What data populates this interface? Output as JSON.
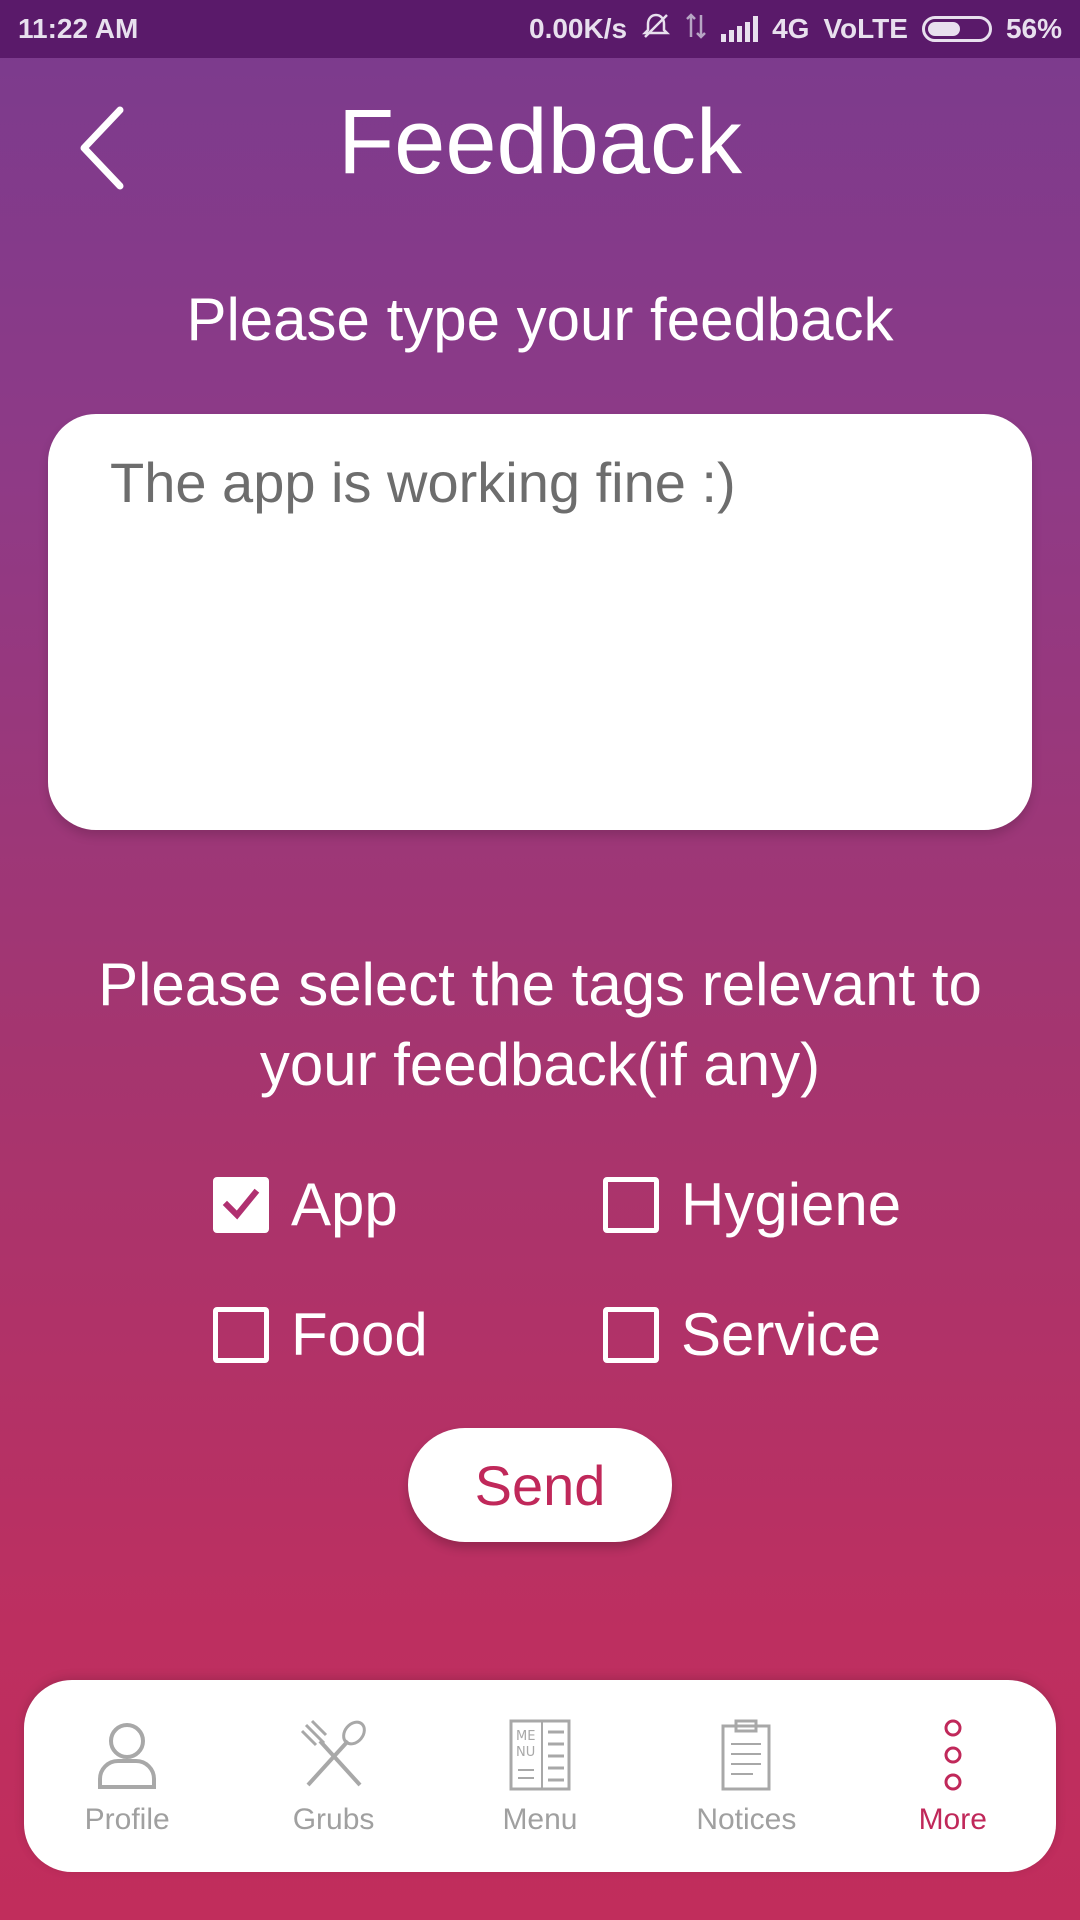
{
  "status_bar": {
    "time": "11:22 AM",
    "speed": "0.00K/s",
    "network": "4G",
    "volte": "VoLTE",
    "battery": "56%",
    "battery_level": 0.56
  },
  "header": {
    "title": "Feedback"
  },
  "feedback": {
    "prompt": "Please type your feedback",
    "value": "The app is working fine :)"
  },
  "tags": {
    "prompt": "Please select the tags relevant to your feedback(if any)",
    "items": [
      {
        "label": "App",
        "checked": true
      },
      {
        "label": "Hygiene",
        "checked": false
      },
      {
        "label": "Food",
        "checked": false
      },
      {
        "label": "Service",
        "checked": false
      }
    ]
  },
  "send_label": "Send",
  "bottom_nav": {
    "items": [
      {
        "label": "Profile",
        "icon": "person-icon"
      },
      {
        "label": "Grubs",
        "icon": "fork-spoon-icon"
      },
      {
        "label": "Menu",
        "icon": "menu-card-icon"
      },
      {
        "label": "Notices",
        "icon": "clipboard-icon"
      },
      {
        "label": "More",
        "icon": "more-dots-icon",
        "active": true
      }
    ]
  },
  "colors": {
    "accent": "#c0285a",
    "status_bar": "#5a1a6a",
    "gradient_top": "#7a3b8e",
    "gradient_bottom": "#c12d5c"
  }
}
